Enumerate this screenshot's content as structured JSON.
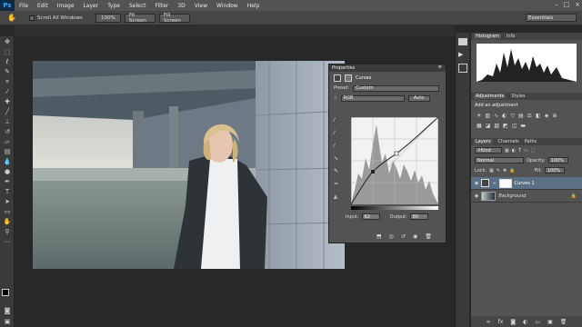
{
  "app_name": "Ps",
  "menu": [
    "File",
    "Edit",
    "Image",
    "Layer",
    "Type",
    "Select",
    "Filter",
    "3D",
    "View",
    "Window",
    "Help"
  ],
  "window_controls": [
    "–",
    "□",
    "×"
  ],
  "options_bar": {
    "scroll_all_windows": "Scroll All Windows",
    "zoom_pct": "100%",
    "fit_screen_1": "Fit Screen",
    "fill_screen": "Fill Screen",
    "workspace": "Essentials"
  },
  "properties": {
    "panel_title": "Properties",
    "type": "Curves",
    "preset_label": "Preset:",
    "preset_value": "Custom",
    "channel": "RGB",
    "auto_label": "Auto",
    "input_label": "Input:",
    "input_value": "62",
    "output_label": "Output:",
    "output_value": "80"
  },
  "histogram": {
    "tab1": "Histogram",
    "tab2": "Info"
  },
  "adjustments": {
    "tab1": "Adjustments",
    "tab2": "Styles",
    "add_label": "Add an adjustment"
  },
  "layers": {
    "tab1": "Layers",
    "tab2": "Channels",
    "tab3": "Paths",
    "kind": "Kind",
    "blend_mode": "Normal",
    "opacity_label": "Opacity:",
    "opacity_value": "100%",
    "lock_label": "Lock:",
    "fill_label": "Fill:",
    "fill_value": "100%",
    "items": [
      {
        "name": "Curves 1"
      },
      {
        "name": "Background"
      }
    ]
  },
  "colors": {
    "accent": "#31a8ff",
    "selected_layer": "#5b6f85"
  }
}
